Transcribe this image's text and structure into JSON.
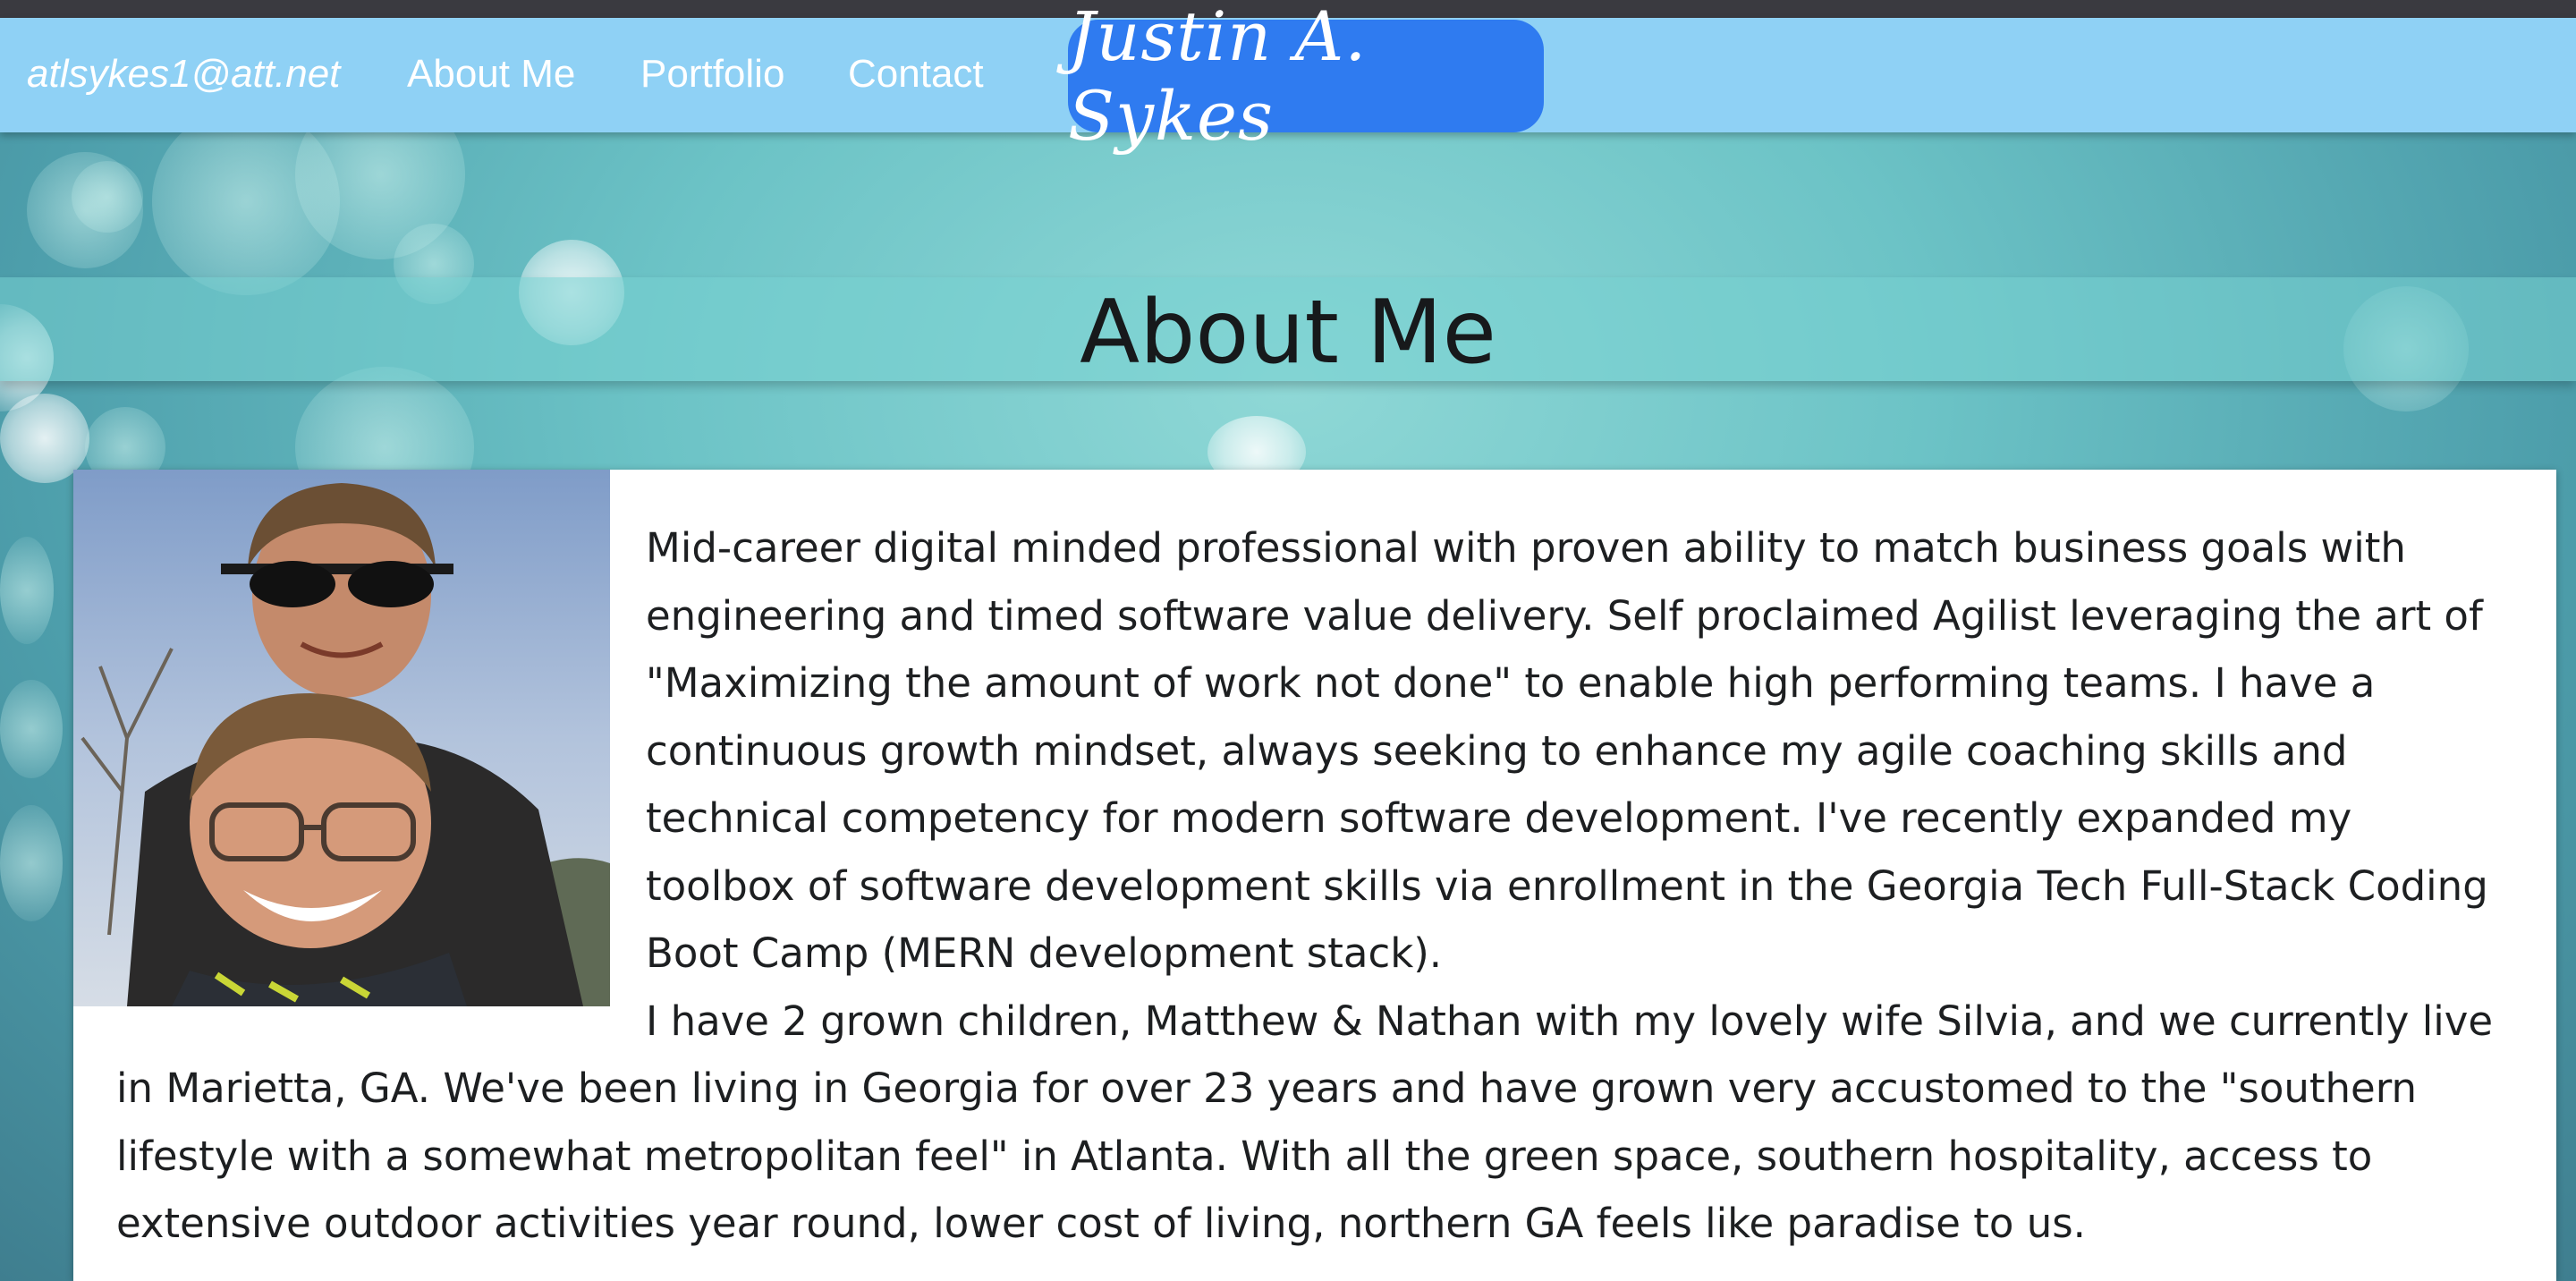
{
  "nav": {
    "email": "atlsykes1@att.net",
    "links": [
      "About Me",
      "Portfolio",
      "Contact"
    ],
    "brand": "Justin A. Sykes"
  },
  "page": {
    "title": "About Me"
  },
  "about": {
    "paragraph1": "Mid-career digital minded professional with proven ability to match business goals with engineering and timed software value delivery. Self proclaimed Agilist leveraging the art of \"Maximizing the amount of work not done\" to enable high performing teams. I have a continuous growth mindset, always seeking to enhance my agile coaching skills and technical competency for modern software development. I've recently expanded my toolbox of software development skills via enrollment in the Georgia Tech Full-Stack Coding Boot Camp (MERN development stack).",
    "paragraph2": "I have 2 grown children, Matthew & Nathan with my lovely wife Silvia, and we currently live in Marietta, GA. We've been living in Georgia for over 23 years and have grown very accustomed to the \"southern lifestyle with a somewhat metropolitan feel\" in Atlanta. With all the green space, southern hospitality, access to extensive outdoor activities year round, lower cost of living, northern GA feels like paradise to us."
  },
  "colors": {
    "navbar": "#8fd1f5",
    "brand_bg": "#2f7bf0",
    "card_bg": "#ffffff"
  }
}
